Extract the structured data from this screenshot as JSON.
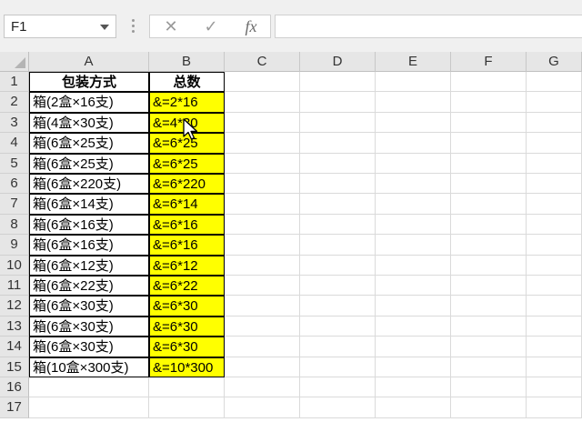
{
  "name_box": {
    "value": "F1"
  },
  "formula_bar": {
    "cancel_icon": "cancel-x-icon",
    "enter_icon": "checkmark-icon",
    "fx_label": "fx",
    "value": ""
  },
  "columns": [
    "A",
    "B",
    "C",
    "D",
    "E",
    "F",
    "G"
  ],
  "rows": [
    "1",
    "2",
    "3",
    "4",
    "5",
    "6",
    "7",
    "8",
    "9",
    "10",
    "11",
    "12",
    "13",
    "14",
    "15",
    "16",
    "17"
  ],
  "header": {
    "a": "包装方式",
    "b": "总数"
  },
  "data": [
    {
      "a": "箱(2盒×16支)",
      "b": "&=2*16"
    },
    {
      "a": "箱(4盒×30支)",
      "b": "&=4*30"
    },
    {
      "a": "箱(6盒×25支)",
      "b": "&=6*25"
    },
    {
      "a": "箱(6盒×25支)",
      "b": "&=6*25"
    },
    {
      "a": "箱(6盒×220支)",
      "b": "&=6*220"
    },
    {
      "a": "箱(6盒×14支)",
      "b": "&=6*14"
    },
    {
      "a": "箱(6盒×16支)",
      "b": "&=6*16"
    },
    {
      "a": "箱(6盒×16支)",
      "b": "&=6*16"
    },
    {
      "a": "箱(6盒×12支)",
      "b": "&=6*12"
    },
    {
      "a": "箱(6盒×22支)",
      "b": "&=6*22"
    },
    {
      "a": "箱(6盒×30支)",
      "b": "&=6*30"
    },
    {
      "a": "箱(6盒×30支)",
      "b": "&=6*30"
    },
    {
      "a": "箱(6盒×30支)",
      "b": "&=6*30"
    },
    {
      "a": "箱(10盒×300支)",
      "b": "&=10*300"
    }
  ],
  "colors": {
    "highlight": "#ffff00",
    "header_bg": "#e6e6e6",
    "toolbar_bg": "#f0f0f0"
  }
}
